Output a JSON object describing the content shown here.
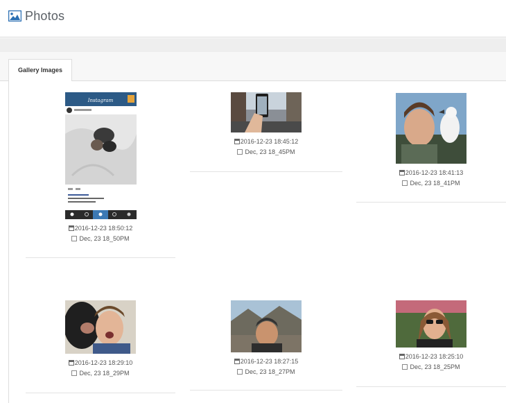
{
  "header": {
    "title": "Photos",
    "icon": "image-icon"
  },
  "tabs": [
    {
      "label": "Gallery Images"
    }
  ],
  "gallery": [
    {
      "timestamp": "2016-12-23 18:50:12",
      "caption": "Dec, 23 18_50PM"
    },
    {
      "timestamp": "2016-12-23 18:45:12",
      "caption": "Dec, 23 18_45PM"
    },
    {
      "timestamp": "2016-12-23 18:41:13",
      "caption": "Dec, 23 18_41PM"
    },
    {
      "timestamp": "2016-12-23 18:29:10",
      "caption": "Dec, 23 18_29PM"
    },
    {
      "timestamp": "2016-12-23 18:27:15",
      "caption": "Dec, 23 18_27PM"
    },
    {
      "timestamp": "2016-12-23 18:25:10",
      "caption": "Dec, 23 18_25PM"
    }
  ],
  "instagram": {
    "app_name": "Instagram"
  },
  "colors": {
    "header_icon": "#2b6fb3",
    "instagram_bar": "#2c5a86"
  }
}
